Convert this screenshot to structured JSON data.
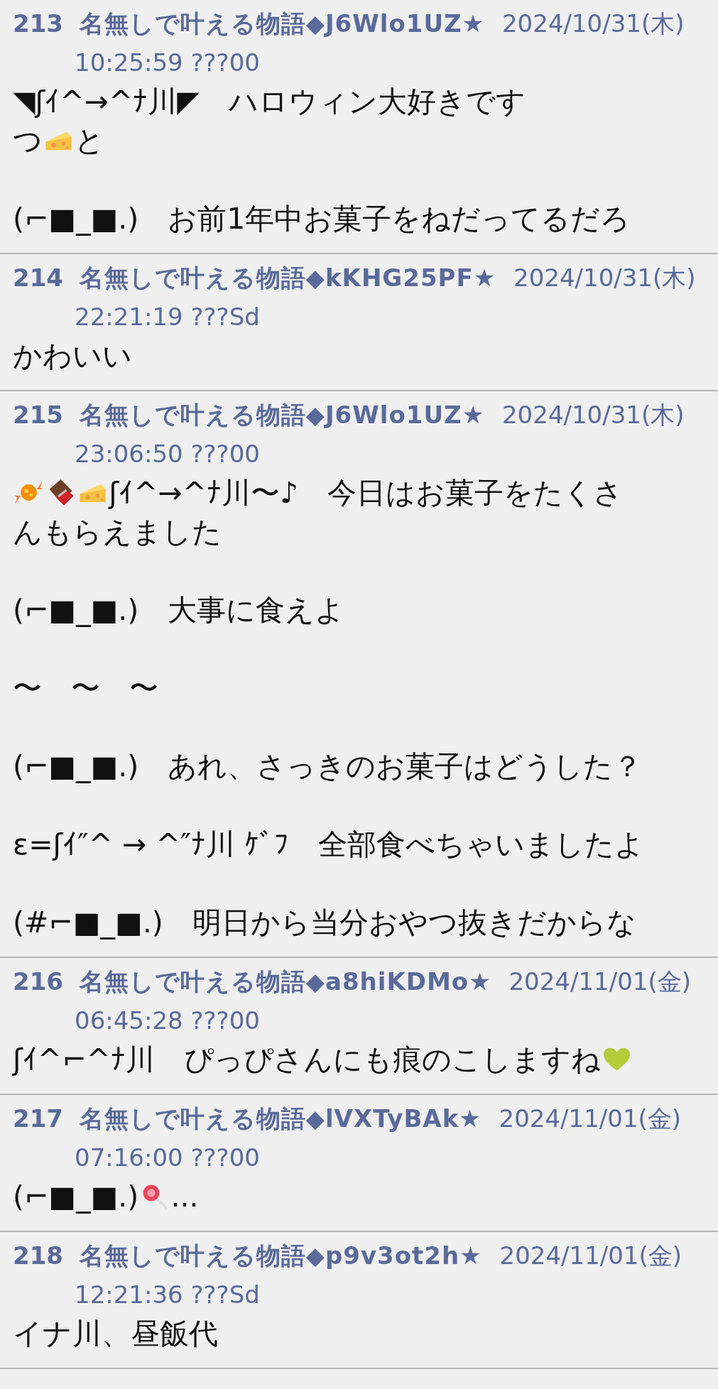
{
  "posts": [
    {
      "number": "213",
      "name": "名無しで叶える物語◆J6Wlo1UZ★",
      "date": "2024/10/31(木)",
      "time": "10:25:59 ???00",
      "paragraphs": [
        [
          [
            {
              "kind": "text",
              "text": "◥ʃｲ^→^ﾅ川◤　ハロウィン大好きです"
            }
          ],
          [
            {
              "kind": "text",
              "text": "つ"
            },
            {
              "kind": "icon"
            },
            {
              "kind": "text",
              "text": "と"
            }
          ]
        ],
        [
          [
            {
              "kind": "text",
              "text": "(⌐■_■.)　お前1年中お菓子をねだってるだろ"
            }
          ]
        ]
      ]
    },
    {
      "number": "214",
      "name": "名無しで叶える物語◆kKHG25PF★",
      "date": "2024/10/31(木)",
      "time": "22:21:19 ???Sd",
      "paragraphs": [
        [
          [
            {
              "kind": "text",
              "text": "かわいい"
            }
          ]
        ]
      ]
    },
    {
      "number": "215",
      "name": "名無しで叶える物語◆J6Wlo1UZ★",
      "date": "2024/10/31(木)",
      "time": "23:06:50 ???00",
      "paragraphs": [
        [
          [
            {
              "kind": "icon"
            },
            {
              "kind": "icon"
            },
            {
              "kind": "icon"
            },
            {
              "kind": "text",
              "text": "ʃｲ^→^ﾅ川〜♪　今日はお菓子をたくさ"
            }
          ],
          [
            {
              "kind": "text",
              "text": "んもらえました"
            }
          ]
        ],
        [
          [
            {
              "kind": "text",
              "text": "(⌐■_■.)　大事に食えよ"
            }
          ]
        ],
        [
          [
            {
              "kind": "text",
              "text": "〜　〜　〜"
            }
          ]
        ],
        [
          [
            {
              "kind": "text",
              "text": "(⌐■_■.)　あれ、さっきのお菓子はどうした？"
            }
          ]
        ],
        [
          [
            {
              "kind": "text",
              "text": "ε=ʃｲ″^ → ^″ﾅ川 ｹﾞﾌ　全部食べちゃいましたよ"
            }
          ]
        ],
        [
          [
            {
              "kind": "text",
              "text": "(#⌐■_■.)　明日から当分おやつ抜きだからな"
            }
          ]
        ]
      ]
    },
    {
      "number": "216",
      "name": "名無しで叶える物語◆a8hiKDMo★",
      "date": "2024/11/01(金)",
      "time": "06:45:28 ???00",
      "paragraphs": [
        [
          [
            {
              "kind": "text",
              "text": "ʃｲ^⌐^ﾅ川　ぴっぴさんにも痕のこしますね"
            },
            {
              "kind": "icon"
            }
          ]
        ]
      ]
    },
    {
      "number": "217",
      "name": "名無しで叶える物語◆lVXTyBAk★",
      "date": "2024/11/01(金)",
      "time": "07:16:00 ???00",
      "paragraphs": [
        [
          [
            {
              "kind": "text",
              "text": "(⌐■_■.)"
            },
            {
              "kind": "icon"
            },
            {
              "kind": "text",
              "text": "..."
            }
          ]
        ]
      ]
    },
    {
      "number": "218",
      "name": "名無しで叶える物語◆p9v3ot2h★",
      "date": "2024/11/01(金)",
      "time": "12:21:36 ???Sd",
      "paragraphs": [
        [
          [
            {
              "kind": "text",
              "text": "イナ川、昼飯代"
            }
          ]
        ]
      ]
    }
  ]
}
